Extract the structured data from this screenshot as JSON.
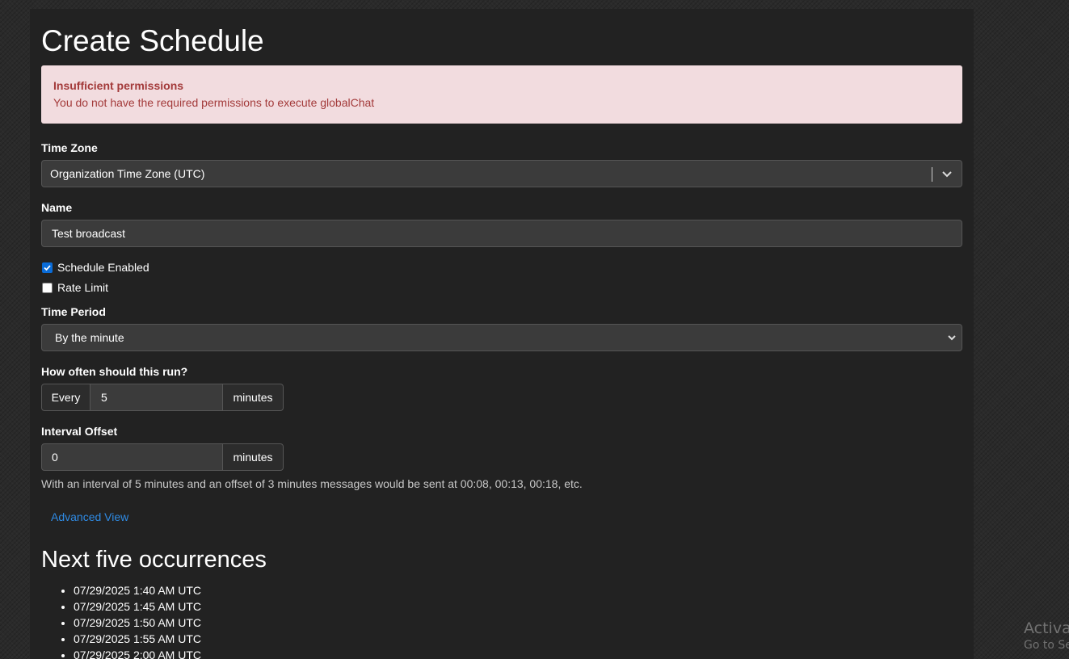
{
  "page": {
    "title": "Create Schedule"
  },
  "alert": {
    "title": "Insufficient permissions",
    "message": "You do not have the required permissions to execute globalChat"
  },
  "form": {
    "time_zone": {
      "label": "Time Zone",
      "value": "Organization Time Zone (UTC)"
    },
    "name": {
      "label": "Name",
      "value": "Test broadcast"
    },
    "schedule_enabled": {
      "label": "Schedule Enabled",
      "checked": true
    },
    "rate_limit": {
      "label": "Rate Limit",
      "checked": false
    },
    "time_period": {
      "label": "Time Period",
      "value": "By the minute"
    },
    "frequency": {
      "label": "How often should this run?",
      "prefix": "Every",
      "value": "5",
      "suffix": "minutes"
    },
    "offset": {
      "label": "Interval Offset",
      "value": "0",
      "suffix": "minutes"
    },
    "help_text": "With an interval of 5 minutes and an offset of 3 minutes messages would be sent at 00:08, 00:13, 00:18, etc."
  },
  "advanced_link": "Advanced View",
  "occurrences": {
    "title": "Next five occurrences",
    "items": [
      "07/29/2025 1:40 AM UTC",
      "07/29/2025 1:45 AM UTC",
      "07/29/2025 1:50 AM UTC",
      "07/29/2025 1:55 AM UTC",
      "07/29/2025 2:00 AM UTC"
    ]
  },
  "watermark": {
    "line1": "Activat",
    "line2": "Go to Se"
  },
  "colors": {
    "panel_bg": "#222222",
    "alert_bg": "#f2dcdf",
    "alert_text": "#a33a3a",
    "link": "#2f8ae3",
    "checkbox_on": "#0a6cd8"
  }
}
